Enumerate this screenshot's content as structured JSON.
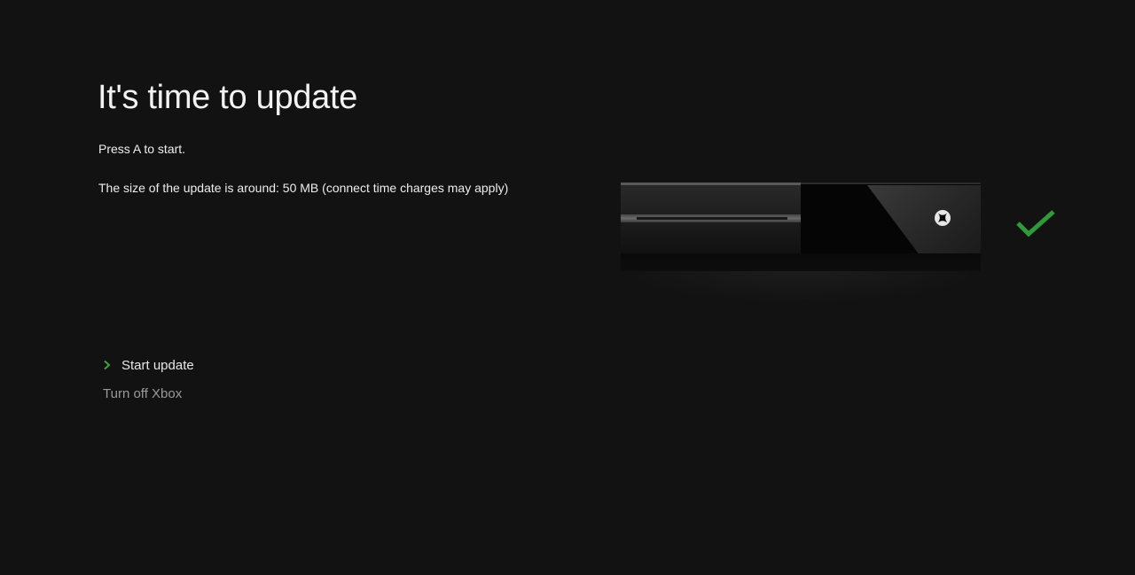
{
  "screen": {
    "title": "It's time to update",
    "instruction": "Press A to start.",
    "size_info": "The size of the update is around: 50 MB (connect time charges may apply)"
  },
  "menu": {
    "items": [
      {
        "label": "Start update",
        "selected": true
      },
      {
        "label": "Turn off Xbox",
        "selected": false
      }
    ]
  },
  "icons": {
    "selection": "chevron-right-icon",
    "console": "xbox-console-icon",
    "logo": "xbox-logo-icon",
    "status": "checkmark-icon"
  },
  "colors": {
    "background": "#121212",
    "accent_green": "#2e9a3a",
    "text_primary": "#ededed",
    "text_secondary": "#9a9a9a"
  }
}
